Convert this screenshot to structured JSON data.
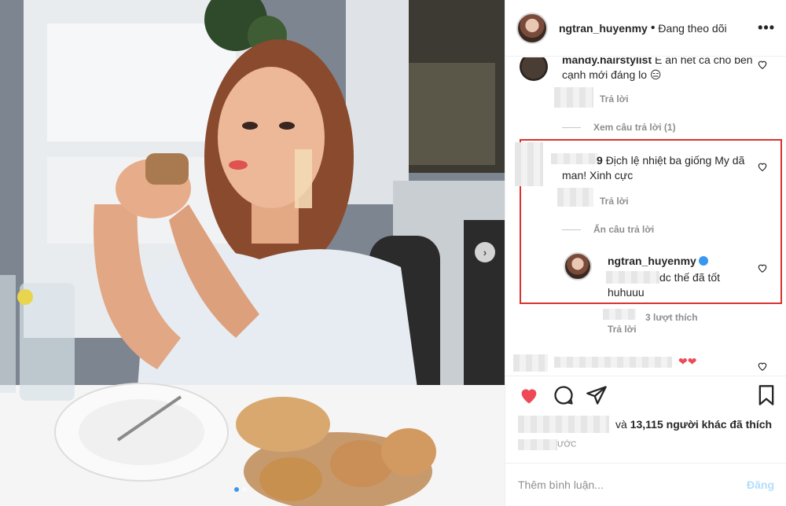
{
  "post": {
    "photo_description_icon": "photo",
    "carousel_next_icon": "chevron-right-icon"
  },
  "header": {
    "username": "ngtran_huyenmy",
    "separator": "•",
    "follow_label": "Đang theo dõi",
    "more_icon": "•••"
  },
  "comments": {
    "c1": {
      "username": "mandy.hairstylist",
      "text": "Ể ăn hết cả chỗ bên cạnh mới đáng lo 😑",
      "reply": "Trả lời"
    },
    "view_replies": "Xem câu trả lời (1)",
    "c2": {
      "username_tail": "9",
      "text": "Địch lệ nhiệt ba giống My dã man! Xinh cực",
      "reply": "Trả lời"
    },
    "hide_replies": "Ẩn câu trả lời",
    "c3": {
      "username": "ngtran_huyenmy",
      "text": "dc thế đã tốt huhuuu",
      "likes": "3 lượt thích",
      "reply": "Trả lời"
    },
    "c4": {
      "text": "❤❤"
    }
  },
  "actions": {
    "like_icon": "heart-filled-icon",
    "comment_icon": "comment-icon",
    "share_icon": "share-icon",
    "save_icon": "bookmark-icon",
    "likes_prefix": "và",
    "likes_count": "13,115",
    "likes_suffix": "người khác đã thích",
    "time_suffix": "ước"
  },
  "composer": {
    "placeholder": "Thêm bình luận...",
    "post_label": "Đăng"
  },
  "colors": {
    "accent": "#3897f0",
    "like": "#ed4956",
    "highlight_box": "#d9322f"
  }
}
